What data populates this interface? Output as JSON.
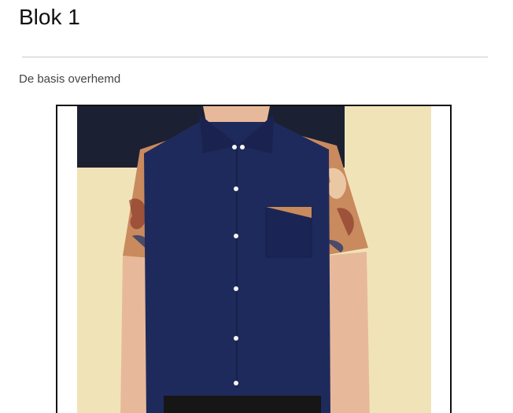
{
  "block": {
    "title": "Blok 1",
    "description": "De basis overhemd"
  },
  "colors": {
    "shirt": "#1f2a5c",
    "background_wall": "#f1e3b8",
    "dark_panel": "#1c2033",
    "skin": "#e7b99a",
    "floral": "#c98a5e",
    "divider": "#c8c8c8"
  },
  "image": {
    "subject": "navy-short-sleeve-shirt-with-floral-sleeves-photo"
  }
}
